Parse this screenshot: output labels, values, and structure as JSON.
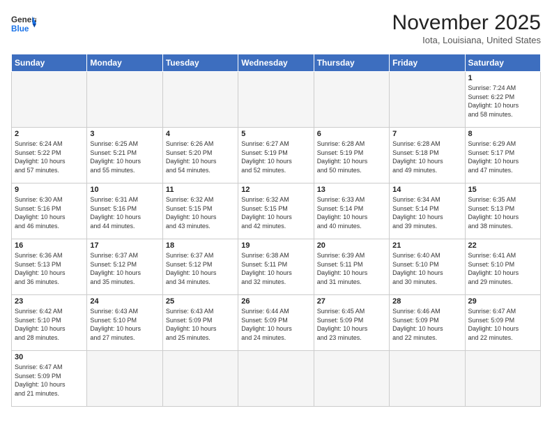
{
  "header": {
    "logo_general": "General",
    "logo_blue": "Blue",
    "month_title": "November 2025",
    "location": "Iota, Louisiana, United States"
  },
  "days_of_week": [
    "Sunday",
    "Monday",
    "Tuesday",
    "Wednesday",
    "Thursday",
    "Friday",
    "Saturday"
  ],
  "weeks": [
    [
      {
        "day": "",
        "info": ""
      },
      {
        "day": "",
        "info": ""
      },
      {
        "day": "",
        "info": ""
      },
      {
        "day": "",
        "info": ""
      },
      {
        "day": "",
        "info": ""
      },
      {
        "day": "",
        "info": ""
      },
      {
        "day": "1",
        "info": "Sunrise: 7:24 AM\nSunset: 6:22 PM\nDaylight: 10 hours\nand 58 minutes."
      }
    ],
    [
      {
        "day": "2",
        "info": "Sunrise: 6:24 AM\nSunset: 5:22 PM\nDaylight: 10 hours\nand 57 minutes."
      },
      {
        "day": "3",
        "info": "Sunrise: 6:25 AM\nSunset: 5:21 PM\nDaylight: 10 hours\nand 55 minutes."
      },
      {
        "day": "4",
        "info": "Sunrise: 6:26 AM\nSunset: 5:20 PM\nDaylight: 10 hours\nand 54 minutes."
      },
      {
        "day": "5",
        "info": "Sunrise: 6:27 AM\nSunset: 5:19 PM\nDaylight: 10 hours\nand 52 minutes."
      },
      {
        "day": "6",
        "info": "Sunrise: 6:28 AM\nSunset: 5:19 PM\nDaylight: 10 hours\nand 50 minutes."
      },
      {
        "day": "7",
        "info": "Sunrise: 6:28 AM\nSunset: 5:18 PM\nDaylight: 10 hours\nand 49 minutes."
      },
      {
        "day": "8",
        "info": "Sunrise: 6:29 AM\nSunset: 5:17 PM\nDaylight: 10 hours\nand 47 minutes."
      }
    ],
    [
      {
        "day": "9",
        "info": "Sunrise: 6:30 AM\nSunset: 5:16 PM\nDaylight: 10 hours\nand 46 minutes."
      },
      {
        "day": "10",
        "info": "Sunrise: 6:31 AM\nSunset: 5:16 PM\nDaylight: 10 hours\nand 44 minutes."
      },
      {
        "day": "11",
        "info": "Sunrise: 6:32 AM\nSunset: 5:15 PM\nDaylight: 10 hours\nand 43 minutes."
      },
      {
        "day": "12",
        "info": "Sunrise: 6:32 AM\nSunset: 5:15 PM\nDaylight: 10 hours\nand 42 minutes."
      },
      {
        "day": "13",
        "info": "Sunrise: 6:33 AM\nSunset: 5:14 PM\nDaylight: 10 hours\nand 40 minutes."
      },
      {
        "day": "14",
        "info": "Sunrise: 6:34 AM\nSunset: 5:14 PM\nDaylight: 10 hours\nand 39 minutes."
      },
      {
        "day": "15",
        "info": "Sunrise: 6:35 AM\nSunset: 5:13 PM\nDaylight: 10 hours\nand 38 minutes."
      }
    ],
    [
      {
        "day": "16",
        "info": "Sunrise: 6:36 AM\nSunset: 5:13 PM\nDaylight: 10 hours\nand 36 minutes."
      },
      {
        "day": "17",
        "info": "Sunrise: 6:37 AM\nSunset: 5:12 PM\nDaylight: 10 hours\nand 35 minutes."
      },
      {
        "day": "18",
        "info": "Sunrise: 6:37 AM\nSunset: 5:12 PM\nDaylight: 10 hours\nand 34 minutes."
      },
      {
        "day": "19",
        "info": "Sunrise: 6:38 AM\nSunset: 5:11 PM\nDaylight: 10 hours\nand 32 minutes."
      },
      {
        "day": "20",
        "info": "Sunrise: 6:39 AM\nSunset: 5:11 PM\nDaylight: 10 hours\nand 31 minutes."
      },
      {
        "day": "21",
        "info": "Sunrise: 6:40 AM\nSunset: 5:10 PM\nDaylight: 10 hours\nand 30 minutes."
      },
      {
        "day": "22",
        "info": "Sunrise: 6:41 AM\nSunset: 5:10 PM\nDaylight: 10 hours\nand 29 minutes."
      }
    ],
    [
      {
        "day": "23",
        "info": "Sunrise: 6:42 AM\nSunset: 5:10 PM\nDaylight: 10 hours\nand 28 minutes."
      },
      {
        "day": "24",
        "info": "Sunrise: 6:43 AM\nSunset: 5:10 PM\nDaylight: 10 hours\nand 27 minutes."
      },
      {
        "day": "25",
        "info": "Sunrise: 6:43 AM\nSunset: 5:09 PM\nDaylight: 10 hours\nand 25 minutes."
      },
      {
        "day": "26",
        "info": "Sunrise: 6:44 AM\nSunset: 5:09 PM\nDaylight: 10 hours\nand 24 minutes."
      },
      {
        "day": "27",
        "info": "Sunrise: 6:45 AM\nSunset: 5:09 PM\nDaylight: 10 hours\nand 23 minutes."
      },
      {
        "day": "28",
        "info": "Sunrise: 6:46 AM\nSunset: 5:09 PM\nDaylight: 10 hours\nand 22 minutes."
      },
      {
        "day": "29",
        "info": "Sunrise: 6:47 AM\nSunset: 5:09 PM\nDaylight: 10 hours\nand 22 minutes."
      }
    ],
    [
      {
        "day": "30",
        "info": "Sunrise: 6:47 AM\nSunset: 5:09 PM\nDaylight: 10 hours\nand 21 minutes."
      },
      {
        "day": "",
        "info": ""
      },
      {
        "day": "",
        "info": ""
      },
      {
        "day": "",
        "info": ""
      },
      {
        "day": "",
        "info": ""
      },
      {
        "day": "",
        "info": ""
      },
      {
        "day": "",
        "info": ""
      }
    ]
  ]
}
